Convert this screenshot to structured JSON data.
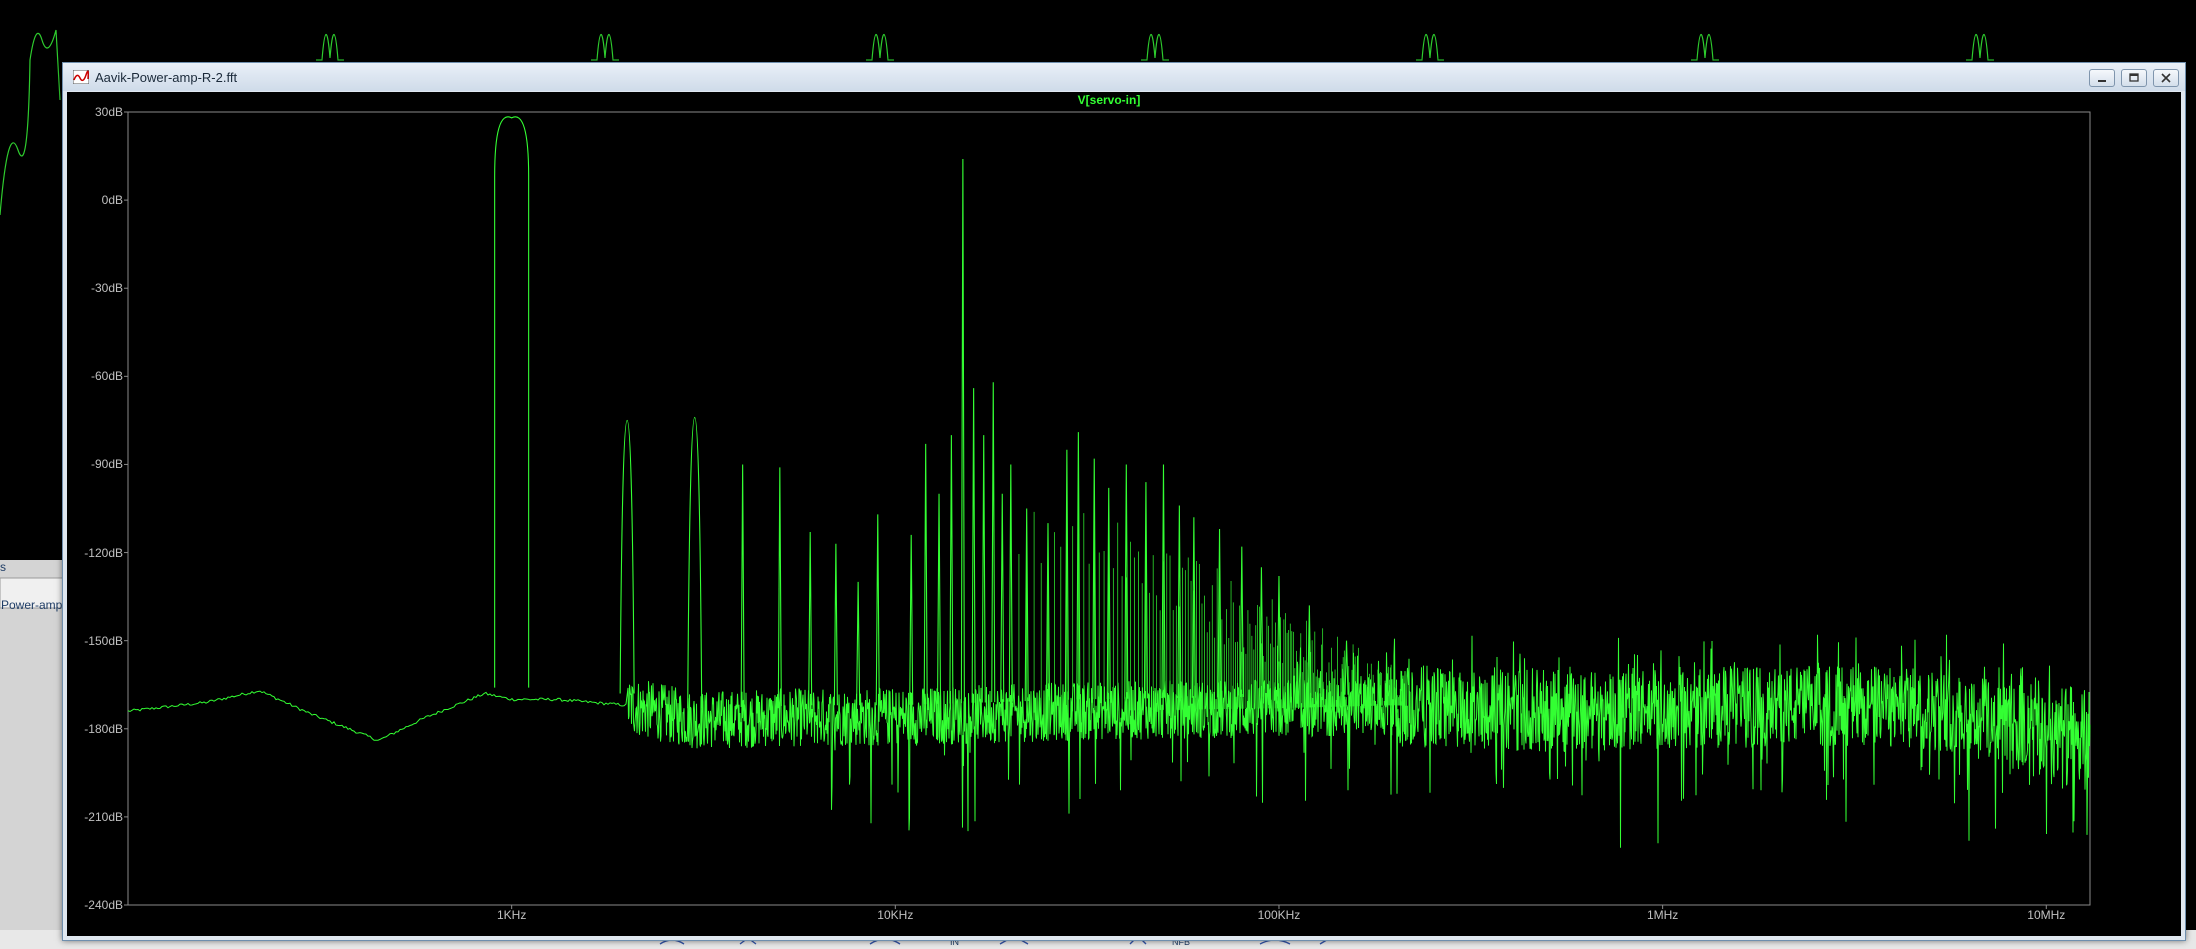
{
  "background": {
    "left_label_1": "s",
    "left_label_2": "Power-amp",
    "bottom_labels": [
      "IN",
      "NFB"
    ]
  },
  "window": {
    "title": "Aavik-Power-amp-R-2.fft",
    "icon": "ltspice-waveform-icon",
    "controls": [
      "minimize-icon",
      "restore-icon",
      "close-icon"
    ]
  },
  "chart_data": {
    "type": "line",
    "title": "V[servo-in]",
    "xlabel": "",
    "ylabel": "",
    "x_scale": "log",
    "xlim": [
      100,
      13000000
    ],
    "ylim": [
      -240,
      30
    ],
    "x_tick_labels": [
      "1KHz",
      "10KHz",
      "100KHz",
      "1MHz",
      "10MHz"
    ],
    "x_ticks": [
      1000,
      10000,
      100000,
      1000000,
      10000000
    ],
    "y_tick_labels": [
      "30dB",
      "0dB",
      "-30dB",
      "-60dB",
      "-90dB",
      "-120dB",
      "-150dB",
      "-180dB",
      "-210dB",
      "-240dB"
    ],
    "y_ticks": [
      30,
      0,
      -30,
      -60,
      -90,
      -120,
      -150,
      -180,
      -210,
      -240
    ],
    "series": [
      {
        "name": "V[servo-in]",
        "color": "#33ff33",
        "noise_floor": {
          "x": [
            100,
            160,
            220,
            300,
            450,
            600,
            850,
            1000,
            1300,
            2000,
            3000,
            6000,
            10000,
            30000,
            100000,
            200000,
            500000,
            1000000,
            3000000,
            6000000,
            9000000,
            13000000
          ],
          "y": [
            -174,
            -171,
            -167,
            -175,
            -184,
            -176,
            -168,
            -170,
            -170,
            -172,
            -177,
            -176,
            -176,
            -174,
            -173,
            -172,
            -174,
            -173,
            -172,
            -174,
            -180,
            -185
          ]
        },
        "peaks": [
          {
            "x": 1000,
            "y": 28
          },
          {
            "x": 2000,
            "y": -75
          },
          {
            "x": 3000,
            "y": -74
          },
          {
            "x": 4000,
            "y": -90
          },
          {
            "x": 5000,
            "y": -91
          },
          {
            "x": 6000,
            "y": -113
          },
          {
            "x": 7000,
            "y": -117
          },
          {
            "x": 8000,
            "y": -130
          },
          {
            "x": 9000,
            "y": -107
          },
          {
            "x": 11000,
            "y": -114
          },
          {
            "x": 12000,
            "y": -83
          },
          {
            "x": 13000,
            "y": -100
          },
          {
            "x": 14000,
            "y": -80
          },
          {
            "x": 15000,
            "y": 14
          },
          {
            "x": 16000,
            "y": -64
          },
          {
            "x": 17000,
            "y": -80
          },
          {
            "x": 18000,
            "y": -62
          },
          {
            "x": 19000,
            "y": -100
          },
          {
            "x": 20000,
            "y": -90
          },
          {
            "x": 22000,
            "y": -105
          },
          {
            "x": 25000,
            "y": -110
          },
          {
            "x": 28000,
            "y": -85
          },
          {
            "x": 30000,
            "y": -79
          },
          {
            "x": 33000,
            "y": -88
          },
          {
            "x": 36000,
            "y": -98
          },
          {
            "x": 40000,
            "y": -90
          },
          {
            "x": 45000,
            "y": -96
          },
          {
            "x": 50000,
            "y": -90
          },
          {
            "x": 55000,
            "y": -104
          },
          {
            "x": 60000,
            "y": -108
          },
          {
            "x": 70000,
            "y": -112
          },
          {
            "x": 80000,
            "y": -118
          },
          {
            "x": 90000,
            "y": -125
          },
          {
            "x": 100000,
            "y": -128
          },
          {
            "x": 120000,
            "y": -138
          },
          {
            "x": 150000,
            "y": -150
          },
          {
            "x": 8600000,
            "y": -162
          }
        ]
      }
    ]
  }
}
